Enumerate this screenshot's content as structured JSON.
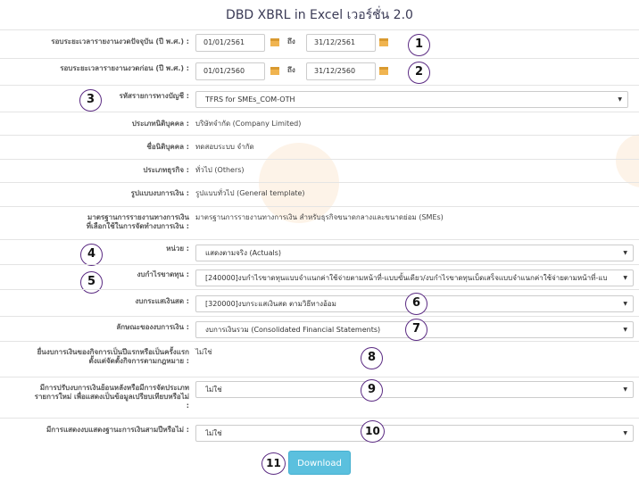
{
  "title": "DBD XBRL in Excel เวอร์ชั่น 2.0",
  "current_period": {
    "label": "รอบระยะเวลารายงานงวดปัจจุบัน (ปี พ.ศ.) :",
    "from": "01/01/2561",
    "to_word": "ถึง",
    "to": "31/12/2561",
    "badge": "1"
  },
  "previous_period": {
    "label": "รอบระยะเวลารายงานงวดก่อน (ปี พ.ศ.) :",
    "from": "01/01/2560",
    "to_word": "ถึง",
    "to": "31/12/2560",
    "badge": "2"
  },
  "account_code": {
    "label": "รหัสรายการทางบัญชี :",
    "value": "TFRS for SMEs_COM-OTH",
    "badge": "3"
  },
  "entity_type": {
    "label": "ประเภทนิติบุคคล :",
    "value": "บริษัทจำกัด (Company Limited)"
  },
  "entity_name": {
    "label": "ชื่อนิติบุคคล :",
    "value": "ทดสอบระบบ จำกัด"
  },
  "business_type": {
    "label": "ประเภทธุรกิจ :",
    "value": "ทั่วไป (Others)"
  },
  "fs_format": {
    "label": "รูปแบบงบการเงิน :",
    "value": "รูปแบบทั่วไป (General template)"
  },
  "standard": {
    "label_line1": "มาตรฐานการรายงานทางการเงิน",
    "label_line2": "ที่เลือกใช้ในการจัดทำงบการเงิน :",
    "value": "มาตรฐานการรายงานทางการเงิน สำหรับธุรกิจขนาดกลางและขนาดย่อม (SMEs)"
  },
  "unit": {
    "label": "หน่วย :",
    "value": "แสดงตามจริง (Actuals)",
    "badge": "4"
  },
  "income_statement": {
    "label": "งบกำไรขาดทุน :",
    "value": "[240000]งบกำไรขาดทุนแบบจำแนกค่าใช้จ่ายตามหน้าที่-แบบขั้นเดียว/งบกำไรขาดทุนเบ็ดเสร็จแบบจำแนกค่าใช้จ่ายตามหน้าที่-แบ",
    "badge": "5"
  },
  "cash_flow": {
    "label": "งบกระแสเงินสด :",
    "value": "[320000]งบกระแสเงินสด ตามวิธีทางอ้อม",
    "badge": "6"
  },
  "fs_nature": {
    "label": "ลักษณะของงบการเงิน :",
    "value": "งบการเงินรวม (Consolidated Financial Statements)",
    "badge": "7"
  },
  "first_time": {
    "label_line1": "ยื่นงบการเงินของกิจการเป็นปีแรกหรือเป็นครั้งแรก",
    "label_line2": "ตั้งแต่จัดตั้งกิจการตามกฎหมาย :",
    "value": "ไม่ใช่",
    "badge": "8"
  },
  "restatement": {
    "label_line1": "มีการปรับงบการเงินย้อนหลังหรือมีการจัดประเภท",
    "label_line2": "รายการใหม่ เพื่อแสดงเป็นข้อมูลเปรียบเทียบหรือไม่",
    "label_line3": ":",
    "value": "ไม่ใช่",
    "badge": "9"
  },
  "three_statements": {
    "label": "มีการแสดงงบแสดงฐานะการเงินสามปีหรือไม่ :",
    "value": "ไม่ใช่",
    "badge": "10"
  },
  "download": {
    "label": "Download",
    "badge": "11"
  },
  "colors": {
    "badge_border": "#5a2a82",
    "button": "#5bc0de",
    "calendar": "#f0b450"
  }
}
